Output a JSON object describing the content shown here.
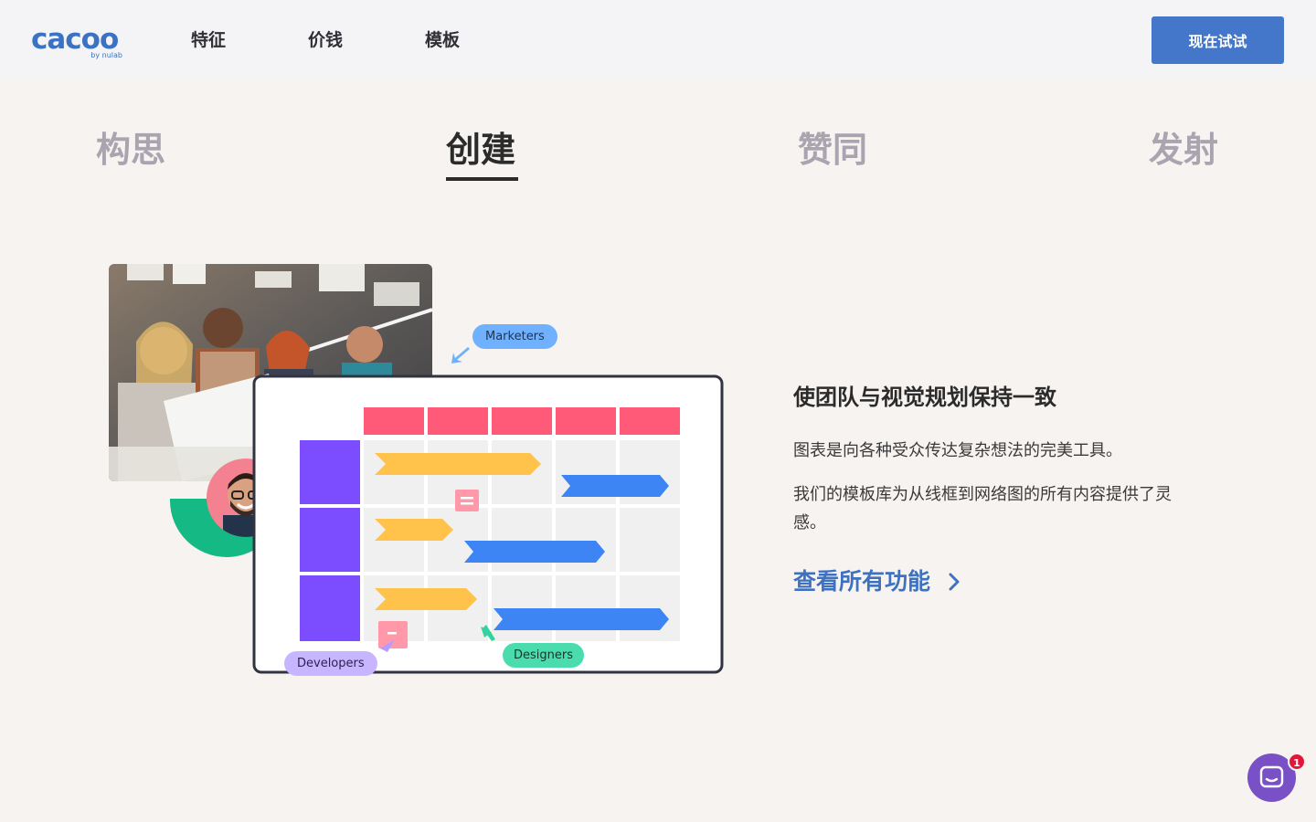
{
  "header": {
    "logo_text": "cacoo",
    "logo_sub": "by nulab",
    "nav": [
      "特征",
      "价钱",
      "模板"
    ],
    "cta_label": "现在试试"
  },
  "tabs": [
    {
      "label": "构思",
      "active": false
    },
    {
      "label": "创建",
      "active": true
    },
    {
      "label": "赞同",
      "active": false
    },
    {
      "label": "发射",
      "active": false
    }
  ],
  "illustration": {
    "tags": {
      "marketers": "Marketers",
      "developers": "Developers",
      "designers": "Designers"
    }
  },
  "content": {
    "heading": "使团队与视觉规划保持一致",
    "paragraph1": "图表是向各种受众传达复杂想法的完美工具。",
    "paragraph2": "我们的模板库为从线框到网络图的所有内容提供了灵感。",
    "link_label": "查看所有功能"
  },
  "chat": {
    "badge_count": "1"
  },
  "colors": {
    "brand": "#4477c9",
    "timeline_header": "#ff5a78",
    "timeline_side": "#7b4dff",
    "bar_yellow": "#ffc24a",
    "bar_blue": "#3d84f5",
    "tag_marketers": "#6fb1ff",
    "tag_developers": "#c7b6ff",
    "tag_designers": "#4bdcae"
  }
}
